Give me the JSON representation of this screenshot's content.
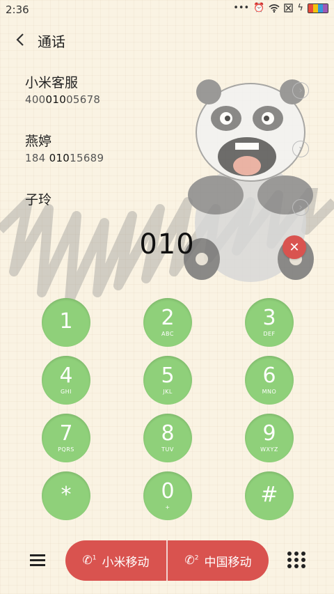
{
  "status_bar": {
    "time": "2:36",
    "icons": [
      "more-icon",
      "alarm-icon",
      "wifi-icon",
      "sim-off-icon",
      "charging-icon",
      "battery-icon"
    ]
  },
  "header": {
    "title": "通话"
  },
  "contacts": [
    {
      "name": "小米客服",
      "number_pre": "400",
      "number_match": "010",
      "number_post": "05678"
    },
    {
      "name": "燕婷",
      "number_pre": "184 ",
      "number_match": "010",
      "number_post": "15689"
    },
    {
      "name": "子玲",
      "number_pre": "",
      "number_match": "",
      "number_post": ""
    }
  ],
  "dial": {
    "digits": "010"
  },
  "keypad": [
    {
      "main": "1",
      "sub": ""
    },
    {
      "main": "2",
      "sub": "ABC"
    },
    {
      "main": "3",
      "sub": "DEF"
    },
    {
      "main": "4",
      "sub": "GHI"
    },
    {
      "main": "5",
      "sub": "JKL"
    },
    {
      "main": "6",
      "sub": "MNO"
    },
    {
      "main": "7",
      "sub": "PQRS"
    },
    {
      "main": "8",
      "sub": "TUV"
    },
    {
      "main": "9",
      "sub": "WXYZ"
    },
    {
      "main": "*",
      "sub": ""
    },
    {
      "main": "0",
      "sub": "+"
    },
    {
      "main": "#",
      "sub": ""
    }
  ],
  "bottom": {
    "sim1_label": "小米移动",
    "sim1_slot": "1",
    "sim2_label": "中国移动",
    "sim2_slot": "2"
  },
  "colors": {
    "background": "#faf3e3",
    "key_green": "#8fd07a",
    "call_red": "#d9534f"
  }
}
